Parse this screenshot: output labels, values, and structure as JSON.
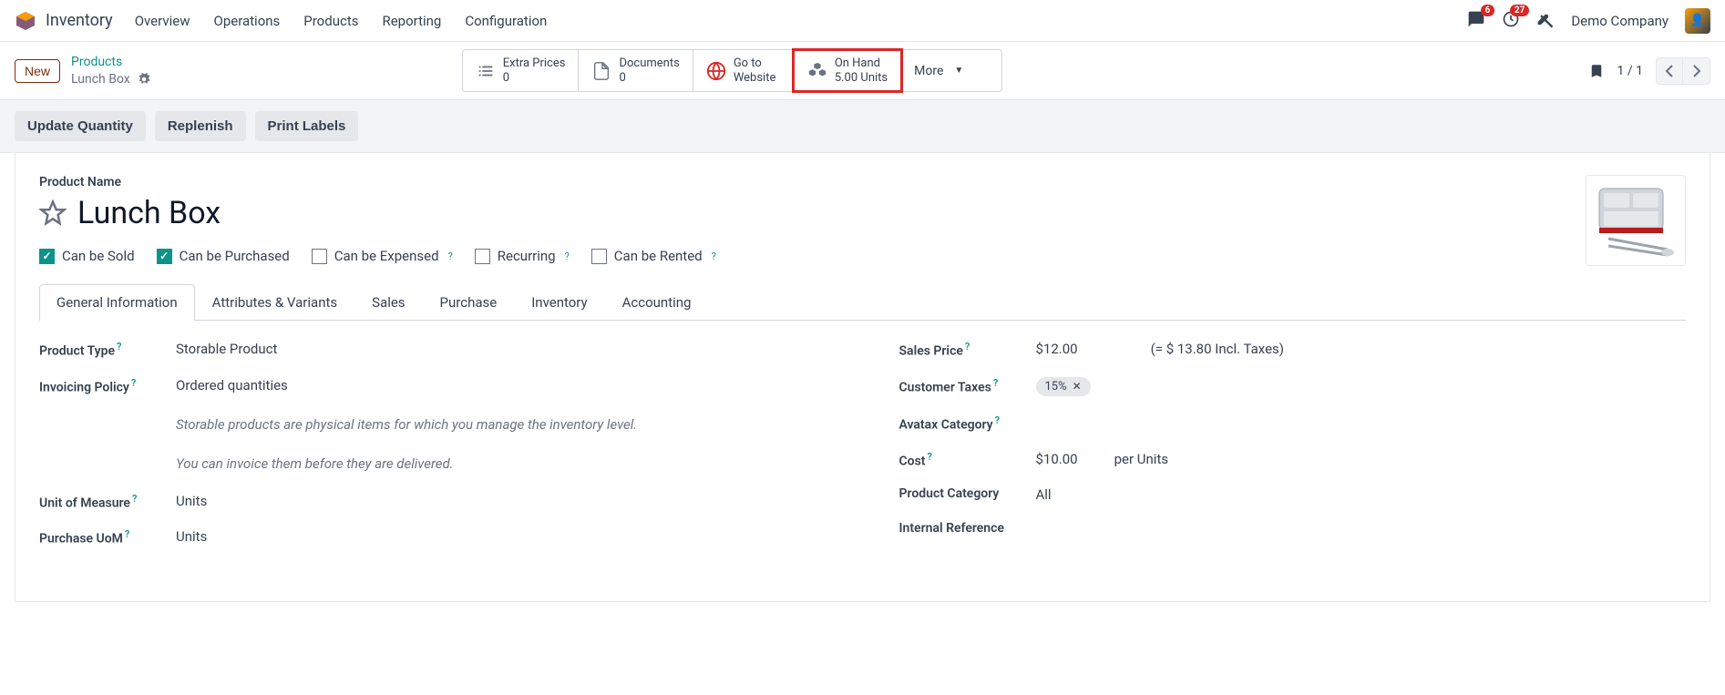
{
  "app": {
    "title": "Inventory"
  },
  "topnav": [
    "Overview",
    "Operations",
    "Products",
    "Reporting",
    "Configuration"
  ],
  "badges": {
    "messages": "6",
    "activities": "27"
  },
  "company": "Demo Company",
  "new_btn": "New",
  "breadcrumb": {
    "parent": "Products",
    "current": "Lunch Box"
  },
  "statboxes": {
    "extra_prices": {
      "label": "Extra Prices",
      "value": "0"
    },
    "documents": {
      "label": "Documents",
      "value": "0"
    },
    "website": {
      "line1": "Go to",
      "line2": "Website"
    },
    "on_hand": {
      "label": "On Hand",
      "value": "5.00 Units"
    },
    "more": "More"
  },
  "pager": "1 / 1",
  "actions": {
    "update_qty": "Update Quantity",
    "replenish": "Replenish",
    "print": "Print Labels"
  },
  "product": {
    "name_label": "Product Name",
    "name": "Lunch Box",
    "checks": {
      "sold": "Can be Sold",
      "purchased": "Can be Purchased",
      "expensed": "Can be Expensed",
      "recurring": "Recurring",
      "rented": "Can be Rented"
    }
  },
  "tabs": [
    "General Information",
    "Attributes & Variants",
    "Sales",
    "Purchase",
    "Inventory",
    "Accounting"
  ],
  "left_fields": {
    "type": {
      "label": "Product Type",
      "value": "Storable Product"
    },
    "inv_policy": {
      "label": "Invoicing Policy",
      "value": "Ordered quantities"
    },
    "hint1": "Storable products are physical items for which you manage the inventory level.",
    "hint2": "You can invoice them before they are delivered.",
    "uom": {
      "label": "Unit of Measure",
      "value": "Units"
    },
    "puom": {
      "label": "Purchase UoM",
      "value": "Units"
    }
  },
  "right_fields": {
    "sales_price": {
      "label": "Sales Price",
      "value": "$12.00",
      "incl": "(= $ 13.80 Incl. Taxes)"
    },
    "cust_taxes": {
      "label": "Customer Taxes",
      "chip": "15%"
    },
    "avatax": {
      "label": "Avatax Category"
    },
    "cost": {
      "label": "Cost",
      "value": "$10.00",
      "unit": "per Units"
    },
    "category": {
      "label": "Product Category",
      "value": "All"
    },
    "intref": {
      "label": "Internal Reference"
    }
  }
}
